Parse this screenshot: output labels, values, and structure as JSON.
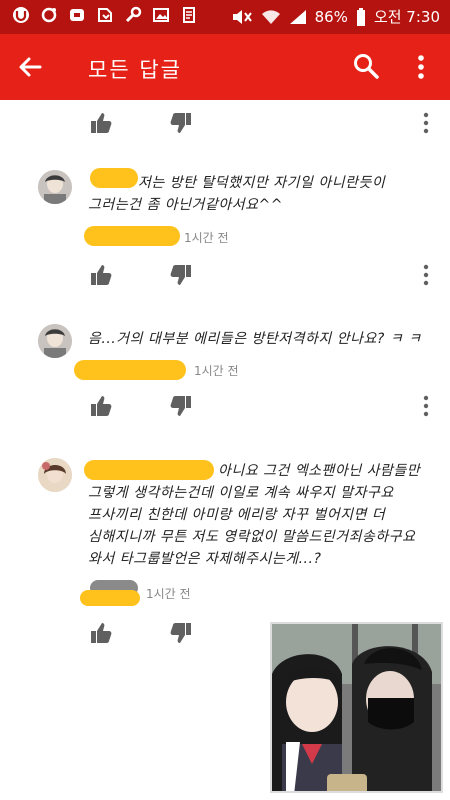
{
  "status_bar": {
    "battery": "86%",
    "time": "오전 7:30"
  },
  "app_bar": {
    "title": "모든 답글"
  },
  "comments": [
    {
      "text_line1": "저는 방탄 탈덕했지만 자기일 아니란듯이",
      "text_line2": "그러는건 좀 아닌거같아서요^^",
      "time": "1시간 전"
    },
    {
      "text_line1": "음...거의 대부분 에리들은 방탄저격하지 안나요? ㅋ ㅋ",
      "time": "1시간 전"
    },
    {
      "text_line1": "아니요 그건 엑소팬아닌 사람들만",
      "text_line2": "그렇게 생각하는건데 이일로 계속 싸우지 말자구요",
      "text_line3": "프사끼리 친한데 아미랑 에리랑  자꾸 벌어지면 더",
      "text_line4": "심해지니까 무튼 저도 영락없이 말씀드린거죄송하구요",
      "text_line5": "와서 타그룹발언은 자제해주시는게...?",
      "time": "1시간 전"
    }
  ],
  "icons": {
    "back": "arrow-left",
    "search": "magnifier",
    "overflow": "three-dots-vertical",
    "like": "thumb-up",
    "dislike": "thumb-down",
    "more": "three-dots-vertical"
  },
  "colors": {
    "app_bar": "#e62117",
    "status_bar": "#b5130f",
    "highlight": "#ffc21c"
  }
}
